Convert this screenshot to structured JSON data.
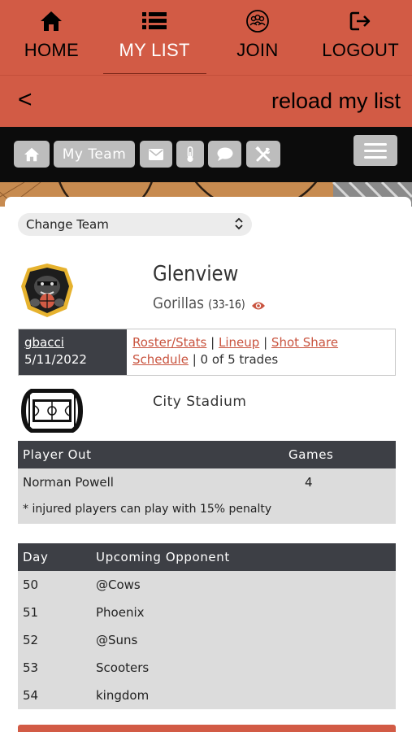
{
  "nav": {
    "items": [
      {
        "label": "HOME",
        "icon": "home-icon"
      },
      {
        "label": "MY LIST",
        "icon": "list-icon"
      },
      {
        "label": "JOIN",
        "icon": "group-icon"
      },
      {
        "label": "LOGOUT",
        "icon": "logout-icon"
      }
    ],
    "active_index": 1
  },
  "reload_bar": {
    "back": "<",
    "reload": "reload my list"
  },
  "toolbar": {
    "my_team": "My Team"
  },
  "team_select": {
    "value": "Change Team"
  },
  "team": {
    "city": "Glenview",
    "name": "Gorillas",
    "record": "(33-16)"
  },
  "info": {
    "user": "gbacci",
    "date": "5/11/2022",
    "links": {
      "roster": "Roster/Stats",
      "lineup": "Lineup",
      "shot_share": "Shot Share",
      "schedule": "Schedule"
    },
    "sep": "|",
    "trades": "| 0 of 5 trades"
  },
  "arena": {
    "name": "City Stadium"
  },
  "injuries": {
    "headers": {
      "player": "Player Out",
      "games": "Games"
    },
    "rows": [
      {
        "player": "Norman Powell",
        "games": "4"
      }
    ],
    "note": "* injured players can play with 15% penalty"
  },
  "schedule": {
    "headers": {
      "day": "Day",
      "opponent": "Upcoming Opponent"
    },
    "rows": [
      {
        "day": "50",
        "opponent": "@Cows"
      },
      {
        "day": "51",
        "opponent": "Phoenix"
      },
      {
        "day": "52",
        "opponent": "@Suns"
      },
      {
        "day": "53",
        "opponent": "Scooters"
      },
      {
        "day": "54",
        "opponent": "kingdom"
      }
    ]
  },
  "colors": {
    "brand": "#d25b45",
    "header_dark": "#3d3f45",
    "link": "#c9543f"
  }
}
